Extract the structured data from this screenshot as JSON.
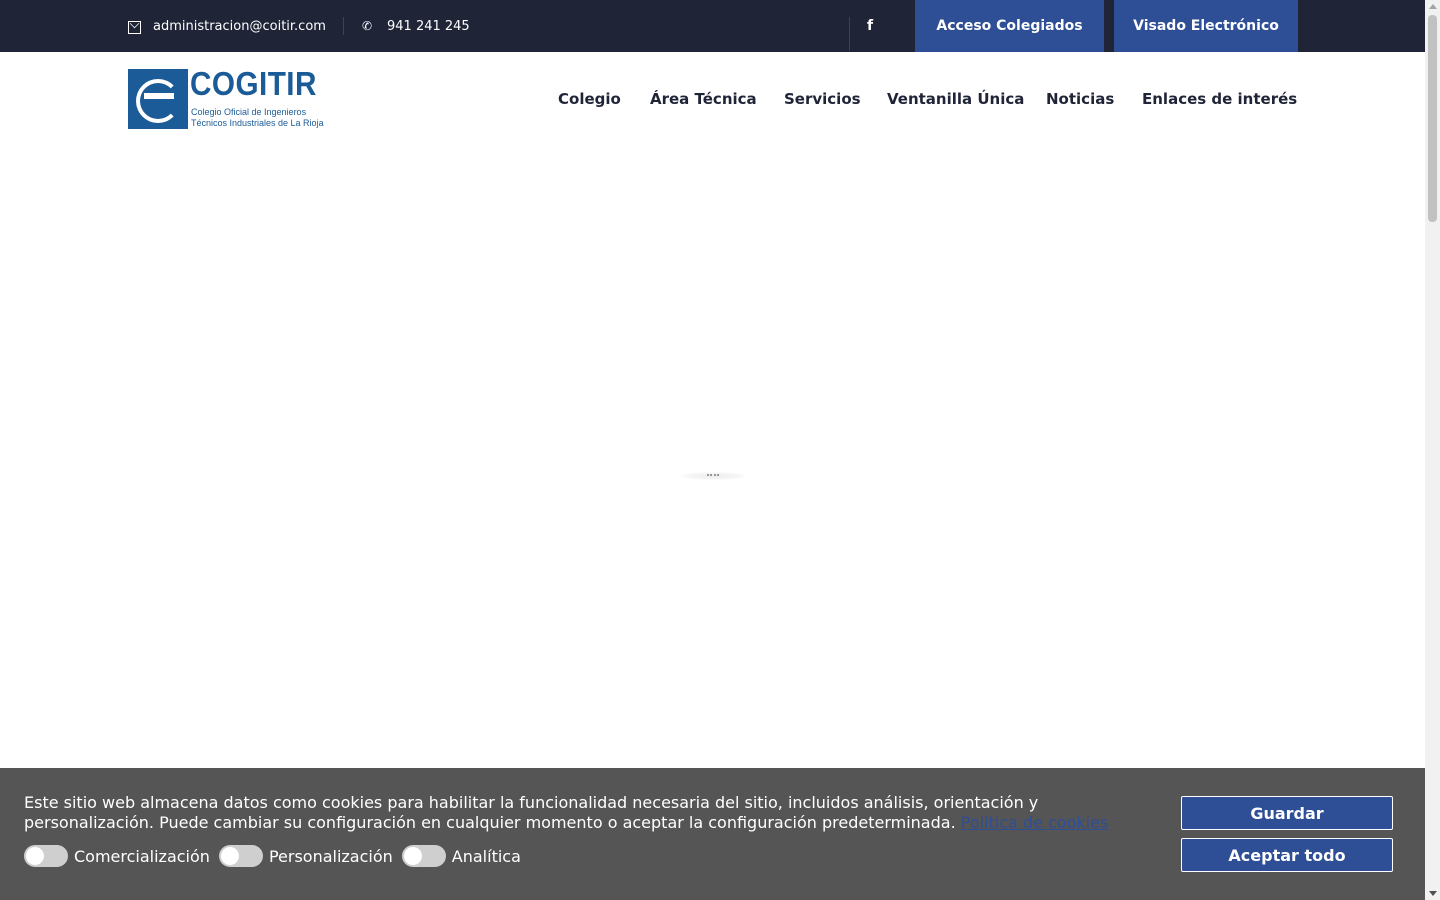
{
  "topbar": {
    "email": "administracion@coitir.com",
    "phone": "941 241 245",
    "facebook_icon": "facebook-icon",
    "buttons": {
      "colegiados": "Acceso Colegiados",
      "visado": "Visado Electrónico"
    }
  },
  "header": {
    "logo": {
      "title": "COGITIR",
      "subtitle_line1": "Colegio Oficial de Ingenieros",
      "subtitle_line2": "Técnicos Industriales de La Rioja"
    },
    "nav": [
      "Colegio",
      "Área Técnica",
      "Servicios",
      "Ventanilla Única",
      "Noticias",
      "Enlaces de interés"
    ]
  },
  "cookie_banner": {
    "text": "Este sitio web almacena datos como cookies para habilitar la funcionalidad necesaria del sitio, incluidos análisis, orientación y personalización. Puede cambiar su configuración en cualquier momento o aceptar la configuración predeterminada.",
    "link_label": "Política de cookies",
    "toggles": [
      {
        "label": "Comercialización",
        "on": false
      },
      {
        "label": "Personalización",
        "on": false
      },
      {
        "label": "Analítica",
        "on": false
      }
    ],
    "save_label": "Guardar",
    "accept_all_label": "Aceptar todo"
  },
  "colors": {
    "topbar_bg": "#1f2437",
    "accent_blue": "#2e4e96",
    "logo_blue": "#1b5b97",
    "banner_bg": "#555555"
  }
}
